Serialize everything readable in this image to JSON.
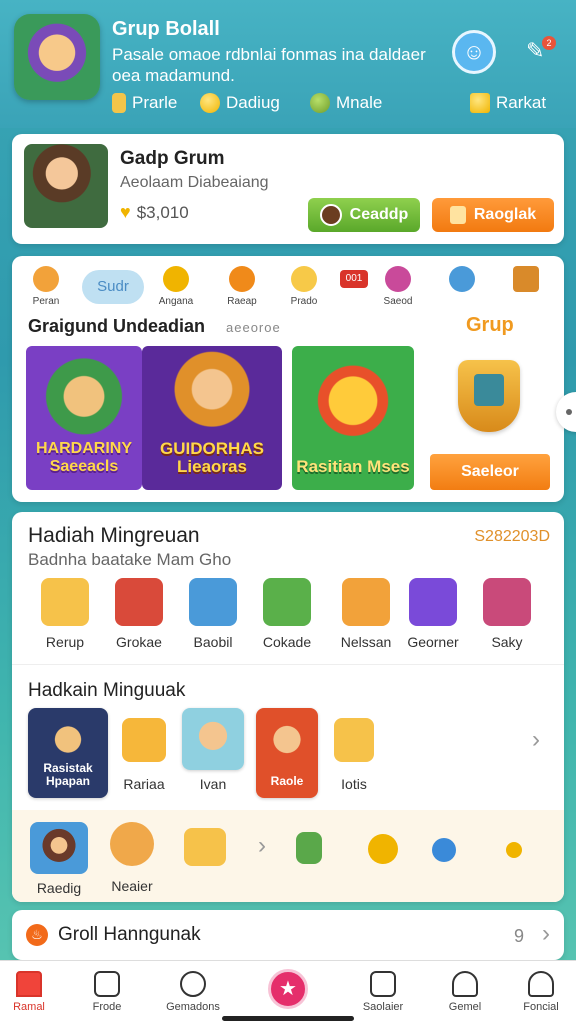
{
  "header": {
    "title": "Grup Bolall",
    "description": "Pasale omaoe rdbnlai fonmas ina daldaer oea madamund.",
    "stats": [
      {
        "label": "Prarle",
        "icon": "tag-icon"
      },
      {
        "label": "Dadiug",
        "icon": "coin-icon"
      },
      {
        "label": "Mnale",
        "icon": "leaf-icon"
      },
      {
        "label": "Rarkat",
        "icon": "gift-icon"
      }
    ],
    "notification_badge": "2"
  },
  "profile_card": {
    "title": "Gadp Grum",
    "subtitle": "Aeolaam Diabeaiang",
    "price": "$3,010",
    "green_button": "Ceaddp",
    "orange_button": "Raoglak"
  },
  "categories": [
    {
      "label": "Peran",
      "color": "#f2a23a"
    },
    {
      "label": "Sudr",
      "pill": true
    },
    {
      "label": "Angana",
      "color": "#f0b400"
    },
    {
      "label": "Raeap",
      "color": "#f08a1a"
    },
    {
      "label": "Prado",
      "color": "#f7c948"
    },
    {
      "label": "001",
      "color": "#d9342a"
    },
    {
      "label": "Saeod",
      "color": "#c94a9a"
    },
    {
      "label": "",
      "color": "#4a9ad9"
    },
    {
      "label": "",
      "color": "#d98a2a"
    }
  ],
  "featured": {
    "title": "Graigund Undeadian",
    "code": "aeeoroe",
    "grup_label": "Grup",
    "banners": [
      "HARDARINY Saeeacls",
      "GUIDORHAS Lieaoras",
      "Rasitian Mses"
    ],
    "cta": "Saeleor"
  },
  "rewards": {
    "title": "Hadiah Mingreuan",
    "code": "S282203D",
    "subtitle": "Badnha baatake Mam Gho",
    "items": [
      "Rerup",
      "Grokae",
      "Baobil",
      "Cokade",
      "Nelssan",
      "Georner",
      "Saky"
    ],
    "colors": [
      "#f6c24a",
      "#d94a3a",
      "#4a9ad9",
      "#5ab04a",
      "#f2a23a",
      "#7a4ad9",
      "#c94a7a"
    ]
  },
  "weekly": {
    "title": "Hadkain Minguuak",
    "tiles": [
      {
        "label": "Rasistak Hpapan",
        "color": "#2a3a6a"
      },
      {
        "label": "Rariaa",
        "color": "#f6b73a"
      },
      {
        "label": "Ivan",
        "color": "#f4c58f"
      },
      {
        "label": "Raole",
        "color": "#e0502a"
      },
      {
        "label": "Iotis",
        "color": "#f6c24a"
      }
    ]
  },
  "extra_row": {
    "items": [
      "Raedig",
      "Neaier"
    ],
    "colors": [
      "#6a3a2a",
      "#f0a84a",
      "#f6c24a",
      "#5aa84a",
      "#f0b400",
      "#3a8ad9",
      "#f0b400"
    ]
  },
  "footer_card": {
    "title": "Groll Hanngunak",
    "count": "9"
  },
  "nav": [
    {
      "label": "Ramal",
      "active": true
    },
    {
      "label": "Frode"
    },
    {
      "label": "Gemadons"
    },
    {
      "label": ""
    },
    {
      "label": "Saolaier"
    },
    {
      "label": "Gemel"
    },
    {
      "label": "Foncial"
    }
  ]
}
